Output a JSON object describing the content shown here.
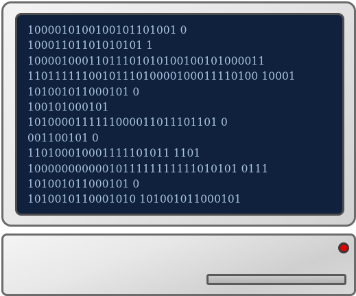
{
  "screen": {
    "lines": [
      "1000010100100101101001 0",
      "10001101101010101 1",
      "10000100011011101010100100101000011",
      "1101111110010111010000100011110100 10001",
      "101001011000101 0",
      "100101000101",
      "1010000111111000011011101101 0",
      "001100101 0",
      "110100010001111101011 1101",
      "1000000000001011111111111010101 0111",
      "101001011000101 0",
      "1010010110001010 101001011000101"
    ]
  },
  "colors": {
    "screen_background": "#10213e",
    "code_text": "#a9c3df",
    "power_led": "#e00000"
  }
}
